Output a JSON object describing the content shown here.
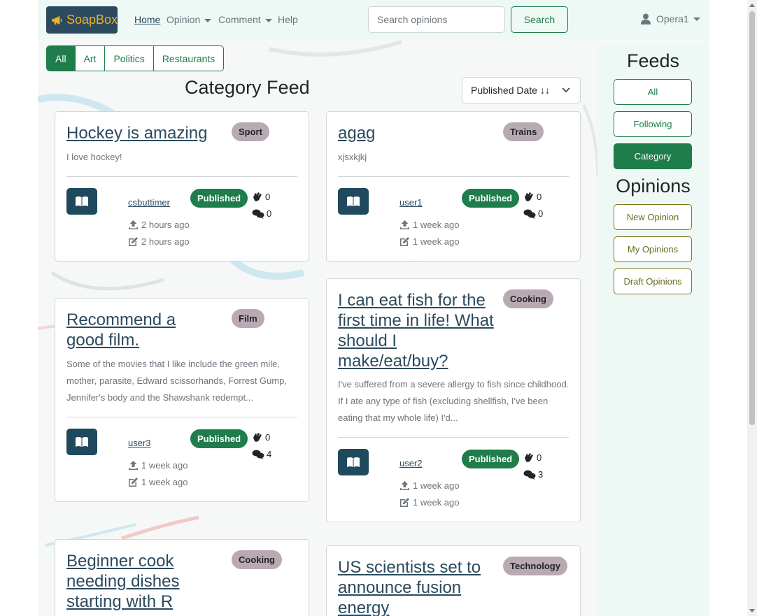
{
  "navbar": {
    "brand": "SoapBox",
    "links": {
      "home": "Home",
      "opinion": "Opinion",
      "comment": "Comment",
      "help": "Help"
    },
    "search_placeholder": "Search opinions",
    "search_button": "Search",
    "user": "Opera1"
  },
  "filters": [
    "All",
    "Art",
    "Politics",
    "Restaurants"
  ],
  "feed_title": "Category Feed",
  "sort": "Published Date ↓↓",
  "cards": [
    {
      "title": "Hockey is amazing",
      "category": "Sport",
      "body": "I love hockey!",
      "author": "csbuttimer",
      "status": "Published",
      "published": "2 hours ago",
      "edited": "2 hours ago",
      "claps": "0",
      "comments": "0"
    },
    {
      "title": "agag",
      "category": "Trains",
      "body": "xjsxkjkj",
      "author": "user1",
      "status": "Published",
      "published": "1 week ago",
      "edited": "1 week ago",
      "claps": "0",
      "comments": "0"
    },
    {
      "title": "Recommend a good film.",
      "category": "Film",
      "body": "Some of the movies that I like include the green mile, mother, parasite, Edward scissorhands, Forrest Gump, Jennifer's body and the Shawshank redempt...",
      "author": "user3",
      "status": "Published",
      "published": "1 week ago",
      "edited": "1 week ago",
      "claps": "0",
      "comments": "4"
    },
    {
      "title": "I can eat fish for the first time in life! What should I make/eat/buy?",
      "category": "Cooking",
      "body": "I've suffered from a severe allergy to fish since childhood. If I ate any type of fish (excluding shellfish, I've been eating that my whole life) I'd...",
      "author": "user2",
      "status": "Published",
      "published": "1 week ago",
      "edited": "1 week ago",
      "claps": "0",
      "comments": "3"
    },
    {
      "title": "Beginner cook needing dishes starting with R",
      "category": "Cooking"
    },
    {
      "title": "US scientists set to announce fusion energy",
      "category": "Technology"
    }
  ],
  "sidebar": {
    "feeds_heading": "Feeds",
    "feeds": [
      "All",
      "Following",
      "Category"
    ],
    "opinions_heading": "Opinions",
    "opinions": [
      "New Opinion",
      "My Opinions",
      "Draft Opinions"
    ]
  },
  "colors": {
    "brand_bg": "#2b4a5e",
    "brand_text": "#f1b21b",
    "primary_green": "#1e7d4a",
    "category_badge": "#b9a9b3",
    "navbar_bg": "#eef8f5"
  },
  "icons": {
    "brand": "megaphone-icon",
    "read": "book-open-icon",
    "published": "upload-icon",
    "edited": "edit-icon",
    "claps": "clap-icon",
    "comments": "comments-icon",
    "user": "user-icon"
  }
}
